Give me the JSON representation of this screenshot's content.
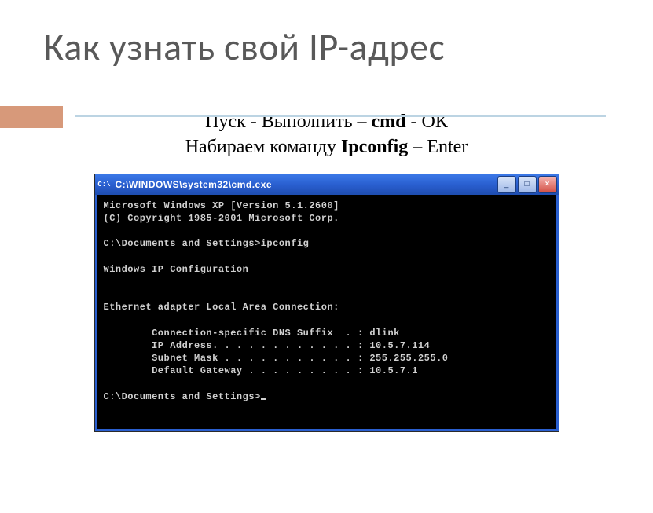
{
  "title": "Как узнать свой IP-адрес",
  "subtitle": {
    "line1": {
      "t1": "Пуск - Выполнить ",
      "b1": "– cmd",
      "t2": "  - ОК"
    },
    "line2": {
      "t1": "Набираем команду ",
      "b1": "Ipconfig –",
      "t2": " Enter"
    }
  },
  "window": {
    "icon_label": "C:\\",
    "title": "C:\\WINDOWS\\system32\\cmd.exe",
    "min": "_",
    "max": "□",
    "close": "×"
  },
  "console": {
    "l1": "Microsoft Windows XP [Version 5.1.2600]",
    "l2": "(C) Copyright 1985-2001 Microsoft Corp.",
    "blank1": " ",
    "l3": "C:\\Documents and Settings>ipconfig",
    "blank2": " ",
    "l4": "Windows IP Configuration",
    "blank3": " ",
    "blank4": " ",
    "l5": "Ethernet adapter Local Area Connection:",
    "blank5": " ",
    "l6": "        Connection-specific DNS Suffix  . : dlink",
    "l7": "        IP Address. . . . . . . . . . . . : 10.5.7.114",
    "l8": "        Subnet Mask . . . . . . . . . . . : 255.255.255.0",
    "l9": "        Default Gateway . . . . . . . . . : 10.5.7.1",
    "blank6": " ",
    "l10": "C:\\Documents and Settings>"
  }
}
